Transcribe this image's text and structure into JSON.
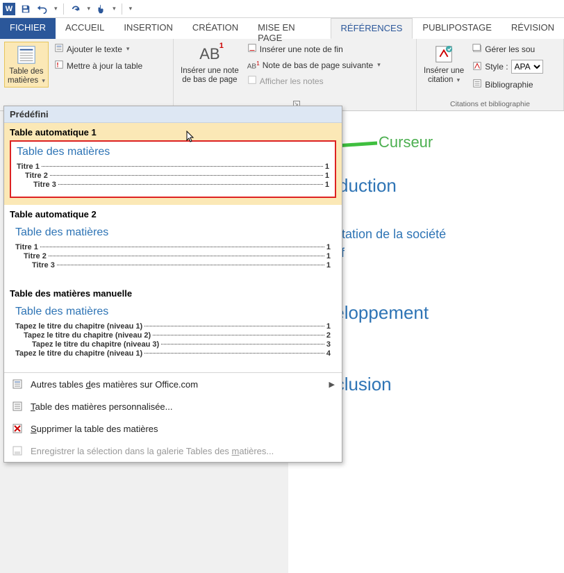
{
  "qat": {
    "app_icon": "W",
    "buttons": [
      "save-icon",
      "undo-icon",
      "redo-icon",
      "touch-icon"
    ]
  },
  "tabs": {
    "file": "FICHIER",
    "home": "ACCUEIL",
    "insert": "INSERTION",
    "create": "CRÉATION",
    "layout": "MISE EN PAGE",
    "references": "RÉFÉRENCES",
    "mailings": "PUBLIPOSTAGE",
    "review": "RÉVISION"
  },
  "ribbon": {
    "toc": {
      "big": "Table des\nmatières",
      "add_text": "Ajouter le texte",
      "update": "Mettre à jour la table"
    },
    "footnotes": {
      "big": "Insérer une note\nde bas de page",
      "ab": "AB",
      "ab_sup": "1",
      "endnote": "Insérer une note de fin",
      "next": "Note de bas de page suivante",
      "show": "Afficher les notes"
    },
    "citations": {
      "big": "Insérer une\ncitation",
      "manage": "Gérer les sou",
      "style_label": "Style :",
      "style_value": "APA",
      "biblio": "Bibliographie",
      "group": "Citations et bibliographie"
    }
  },
  "dropdown": {
    "header": "Prédéfini",
    "auto1": {
      "title": "Table automatique 1",
      "preview_title": "Table des matières",
      "lines": [
        {
          "label": "Titre 1",
          "page": "1",
          "level": 1
        },
        {
          "label": "Titre 2",
          "page": "1",
          "level": 2
        },
        {
          "label": "Titre 3",
          "page": "1",
          "level": 3
        }
      ]
    },
    "auto2": {
      "title": "Table automatique 2",
      "preview_title": "Table des matières",
      "lines": [
        {
          "label": "Titre 1",
          "page": "1",
          "level": 1
        },
        {
          "label": "Titre 2",
          "page": "1",
          "level": 2
        },
        {
          "label": "Titre 3",
          "page": "1",
          "level": 3
        }
      ]
    },
    "manual": {
      "title": "Table des matières manuelle",
      "preview_title": "Table des matières",
      "lines": [
        {
          "label": "Tapez le titre du chapitre (niveau 1)",
          "page": "1",
          "level": 1
        },
        {
          "label": "Tapez le titre du chapitre (niveau 2)",
          "page": "2",
          "level": 2
        },
        {
          "label": "Tapez le titre du chapitre (niveau 3)",
          "page": "3",
          "level": 3
        },
        {
          "label": "Tapez le titre du chapitre (niveau 1)",
          "page": "4",
          "level": 1
        }
      ]
    },
    "menu": {
      "office": "Autres tables des matières sur Office.com",
      "office_d": "d",
      "custom": "Table des matières personnalisée...",
      "custom_t": "T",
      "remove": "Supprimer la table des matières",
      "remove_s": "S",
      "save": "Enregistrer la sélection dans la galerie Tables des matières...",
      "save_m": "m"
    }
  },
  "doc": {
    "cursor_label": "Curseur",
    "h_intro": "Introduction",
    "h_pres": "Présentation de la société",
    "h_obj": "Objectif",
    "h_dev": "Développement",
    "h_conc": "Conclusion"
  }
}
